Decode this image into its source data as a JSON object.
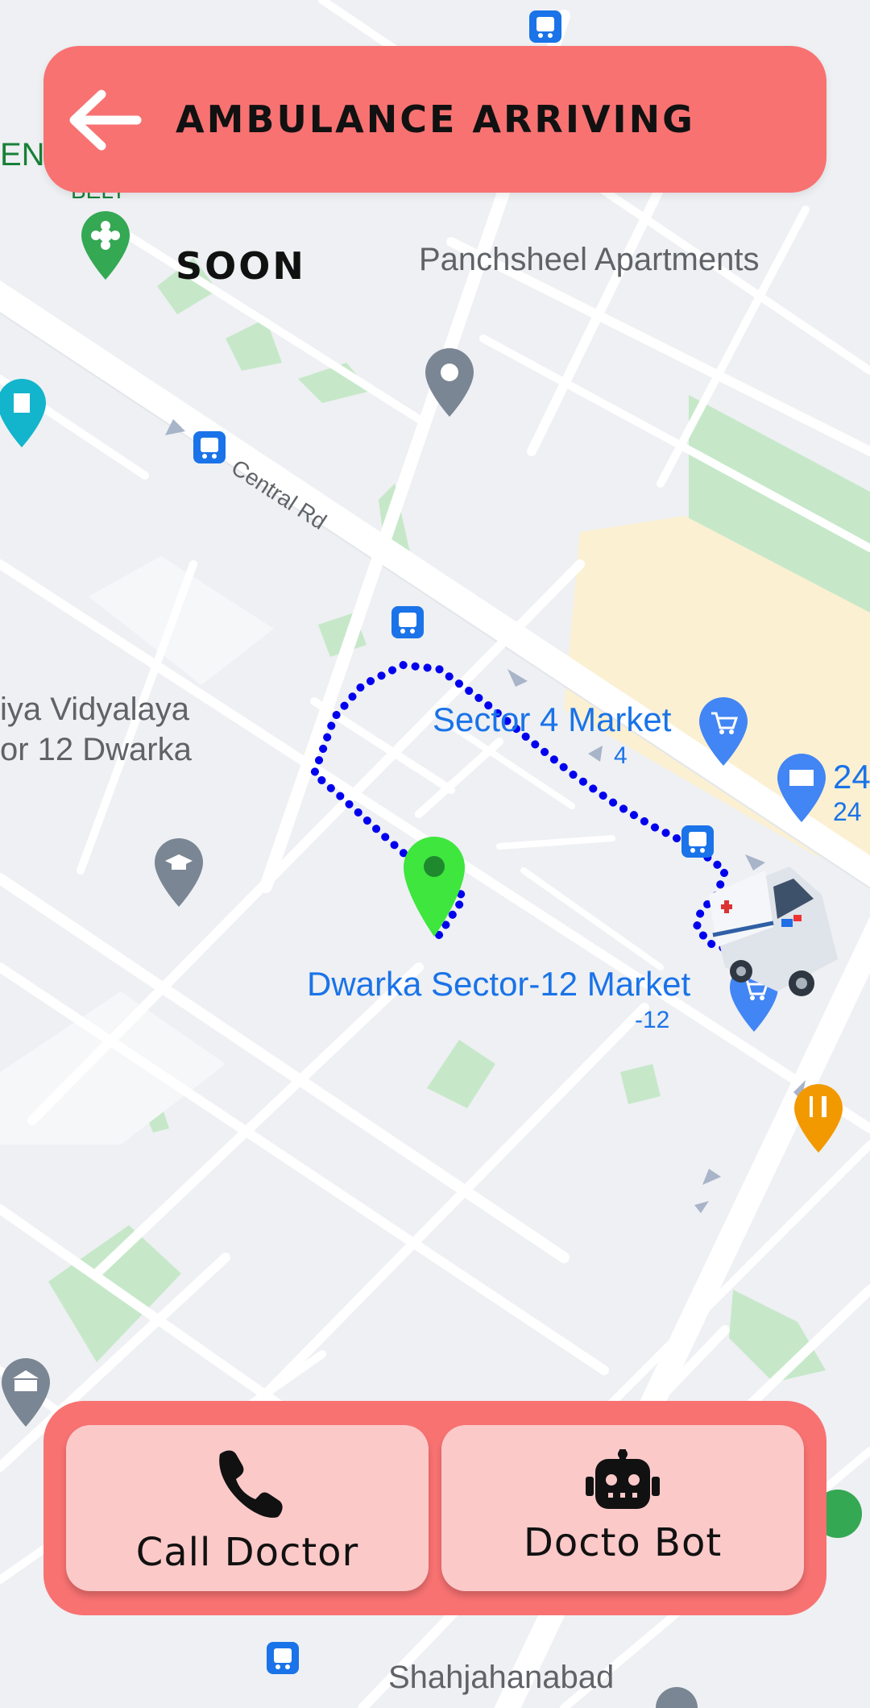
{
  "header": {
    "title": "AMBULANCE ARRIVING SOON",
    "back_icon": "arrow-left-icon"
  },
  "map": {
    "places": {
      "panchsheel": "Panchsheel Apartments",
      "central_rd": "Central Rd",
      "vidyalaya_line1": "iya Vidyalaya",
      "vidyalaya_line2": "or 12 Dwarka",
      "sector4": "Sector 4 Market",
      "sector4_sub": "4",
      "dwarka12": "Dwarka Sector-12 Market",
      "dwarka12_sub": "-12",
      "shahjahanabad": "Shahjahanabad",
      "edge_en": "EN",
      "edge_belt": "BELT",
      "edge_24": "24",
      "edge_24b": "24"
    },
    "colors": {
      "route": "#0000ee",
      "destination_pin": "#3ee63e",
      "place_text": "#1a73e8",
      "park": "#c6e8c9"
    }
  },
  "actions": {
    "call_label": "Call Doctor",
    "call_icon": "phone-icon",
    "bot_label": "Docto Bot",
    "bot_icon": "robot-icon"
  }
}
